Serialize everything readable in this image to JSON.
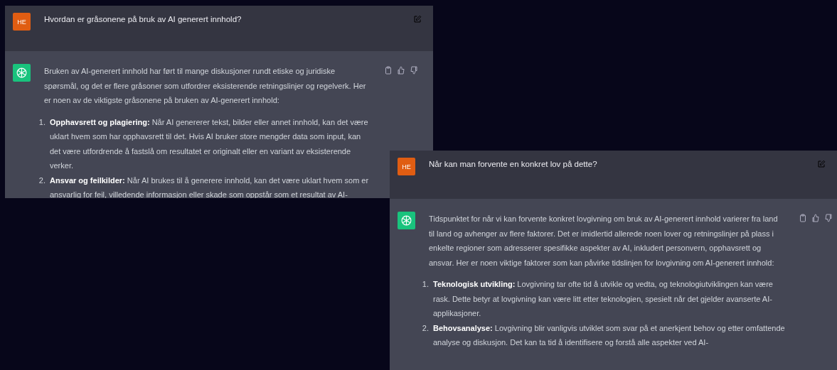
{
  "panels": [
    {
      "question": {
        "avatar": "HE",
        "text": "Hvordan er gråsonene på bruk av AI generert innhold?"
      },
      "answer": {
        "paragraph": "Bruken av AI-generert innhold har ført til mange diskusjoner rundt etiske og juridiske spørsmål, og det er flere gråsoner som utfordrer eksisterende retningslinjer og regelverk. Her er noen av de viktigste gråsonene på bruken av AI-generert innhold:",
        "items": [
          {
            "number": "1.",
            "text": "**Opphavsrett og plagiering:** Når AI genererer tekst, bilder eller annet innhold, kan det være uklart hvem som har opphavsrett til det. Hvis AI bruker store mengder data som input, kan det være utfordrende å fastslå om resultatet er originalt eller en variant av eksisterende verker."
          },
          {
            "number": "2.",
            "text": "**Ansvar og feilkilder:** Når AI brukes til å generere innhold, kan det være uklart hvem som er ansvarlig for feil, villedende informasjon eller skade som oppstår som et resultat av AI-"
          }
        ]
      }
    },
    {
      "question": {
        "avatar": "HE",
        "text": "Når kan man forvente en konkret lov på dette?"
      },
      "answer": {
        "paragraph": "Tidspunktet for når vi kan forvente konkret lovgivning om bruk av AI-generert innhold varierer fra land til land og avhenger av flere faktorer. Det er imidlertid allerede noen lover og retningslinjer på plass i enkelte regioner som adresserer spesifikke aspekter av AI, inkludert personvern, opphavsrett og ansvar. Her er noen viktige faktorer som kan påvirke tidslinjen for lovgivning om AI-generert innhold:",
        "items": [
          {
            "number": "1.",
            "text": "**Teknologisk utvikling:** Lovgivning tar ofte tid å utvikle og vedta, og teknologiutviklingen kan være rask. Dette betyr at lovgivning kan være litt etter teknologien, spesielt når det gjelder avanserte AI-applikasjoner."
          },
          {
            "number": "2.",
            "text": "**Behovsanalyse:** Lovgivning blir vanligvis utviklet som svar på et anerkjent behov og etter omfattende analyse og diskusjon. Det kan ta tid å identifisere og forstå alle aspekter ved AI-"
          }
        ]
      }
    }
  ]
}
